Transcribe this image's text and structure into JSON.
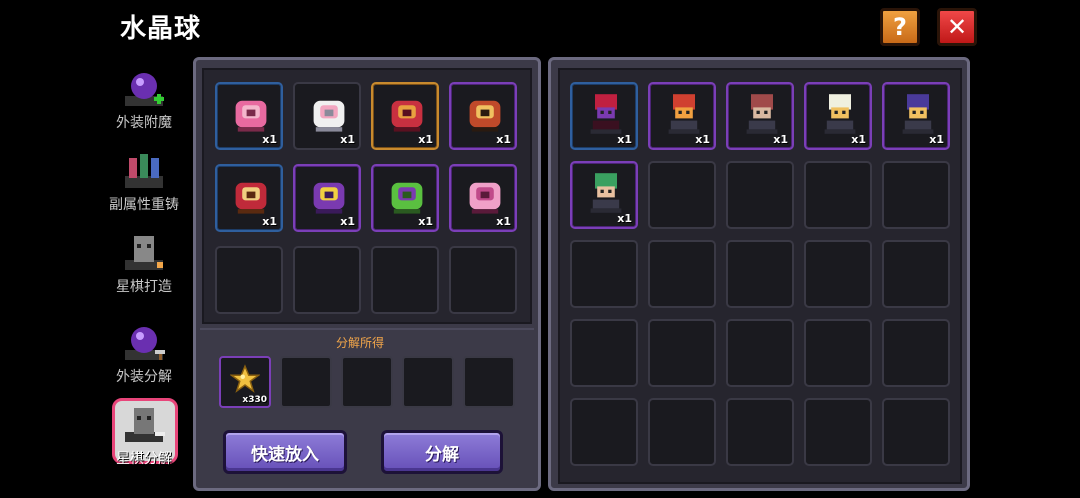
{
  "header": {
    "title": "水晶球",
    "help_label": "?",
    "close_label": "✕"
  },
  "sidebar": {
    "items": [
      {
        "label": "外装附魔",
        "icon": "crystal-ball-enchant-icon",
        "active": false
      },
      {
        "label": "副属性重铸",
        "icon": "gem-reforge-icon",
        "active": false
      },
      {
        "label": "星棋打造",
        "icon": "chess-forge-icon",
        "active": false
      },
      {
        "label": "外装分解",
        "icon": "crystal-ball-decompose-icon",
        "active": false
      },
      {
        "label": "星棋分解",
        "icon": "chess-decompose-icon",
        "active": true
      }
    ]
  },
  "selected_items": {
    "slots": [
      {
        "icon": "pink-bow-chest-icon",
        "count": "x1",
        "rarity": "blue"
      },
      {
        "icon": "white-paw-icon",
        "count": "x1",
        "rarity": "none"
      },
      {
        "icon": "red-spellbook-icon",
        "count": "x1",
        "rarity": "gold"
      },
      {
        "icon": "bell-pet-icon",
        "count": "x1",
        "rarity": "purple"
      },
      {
        "icon": "ribbon-pet-icon",
        "count": "x1",
        "rarity": "blue"
      },
      {
        "icon": "magic-broom-icon",
        "count": "x1",
        "rarity": "purple"
      },
      {
        "icon": "leaf-sprout-icon",
        "count": "x1",
        "rarity": "purple"
      },
      {
        "icon": "pink-wings-icon",
        "count": "x1",
        "rarity": "purple"
      },
      {
        "icon": "",
        "count": "",
        "rarity": "none"
      },
      {
        "icon": "",
        "count": "",
        "rarity": "none"
      },
      {
        "icon": "",
        "count": "",
        "rarity": "none"
      },
      {
        "icon": "",
        "count": "",
        "rarity": "none"
      }
    ]
  },
  "result": {
    "label": "分解所得",
    "slots": [
      {
        "icon": "star-icon",
        "count": "x330",
        "rarity": "purple"
      },
      {
        "icon": "",
        "count": "",
        "rarity": "none"
      },
      {
        "icon": "",
        "count": "",
        "rarity": "none"
      },
      {
        "icon": "",
        "count": "",
        "rarity": "none"
      },
      {
        "icon": "",
        "count": "",
        "rarity": "none"
      }
    ]
  },
  "actions": {
    "quick_add_label": "快速放入",
    "decompose_label": "分解"
  },
  "inventory": {
    "slots": [
      {
        "icon": "red-hood-chess-icon",
        "count": "x1",
        "rarity": "blue"
      },
      {
        "icon": "horned-warrior-chess-icon",
        "count": "x1",
        "rarity": "purple"
      },
      {
        "icon": "bandana-chess-icon",
        "count": "x1",
        "rarity": "purple"
      },
      {
        "icon": "chef-chess-icon",
        "count": "x1",
        "rarity": "purple"
      },
      {
        "icon": "wizard-hat-chess-icon",
        "count": "x1",
        "rarity": "purple"
      },
      {
        "icon": "green-helmet-chess-icon",
        "count": "x1",
        "rarity": "purple"
      }
    ],
    "total_slots": 25
  },
  "colors": {
    "accent_orange": "#f2a64a",
    "button_purple": "#7b66c8",
    "rarity_blue": "#2f5f9e",
    "rarity_purple": "#7b3fb8",
    "rarity_gold": "#c88a2e"
  }
}
